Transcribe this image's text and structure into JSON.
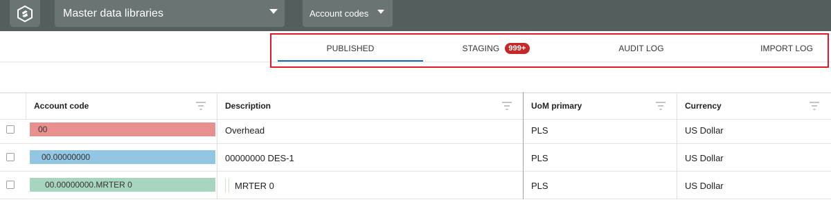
{
  "topbar": {
    "library_select": "Master data libraries",
    "account_select": "Account codes"
  },
  "tabs": [
    {
      "label": "PUBLISHED",
      "active": true
    },
    {
      "label": "STAGING",
      "badge": "999+"
    },
    {
      "label": "AUDIT LOG"
    },
    {
      "label": "IMPORT LOG"
    }
  ],
  "table": {
    "columns": [
      "Account code",
      "Description",
      "UoM primary",
      "Currency"
    ],
    "rows": [
      {
        "code": "00",
        "code_color": "#e88f8f",
        "description": "Overhead",
        "uom": "PLS",
        "currency": "US Dollar"
      },
      {
        "code": "00.00000000",
        "code_color": "#93c6e2",
        "description": "00000000 DES-1",
        "uom": "PLS",
        "currency": "US Dollar"
      },
      {
        "code": "00.00000000.MRTER 0",
        "code_color": "#a8d5bf",
        "description": "MRTER 0",
        "uom": "PLS",
        "currency": "US Dollar"
      }
    ]
  },
  "colors": {
    "topbar": "#535e5e",
    "topbar_control": "#6a7473",
    "tab_underline": "#1565c0",
    "badge": "#c62828",
    "highlight": "#e0192b"
  }
}
